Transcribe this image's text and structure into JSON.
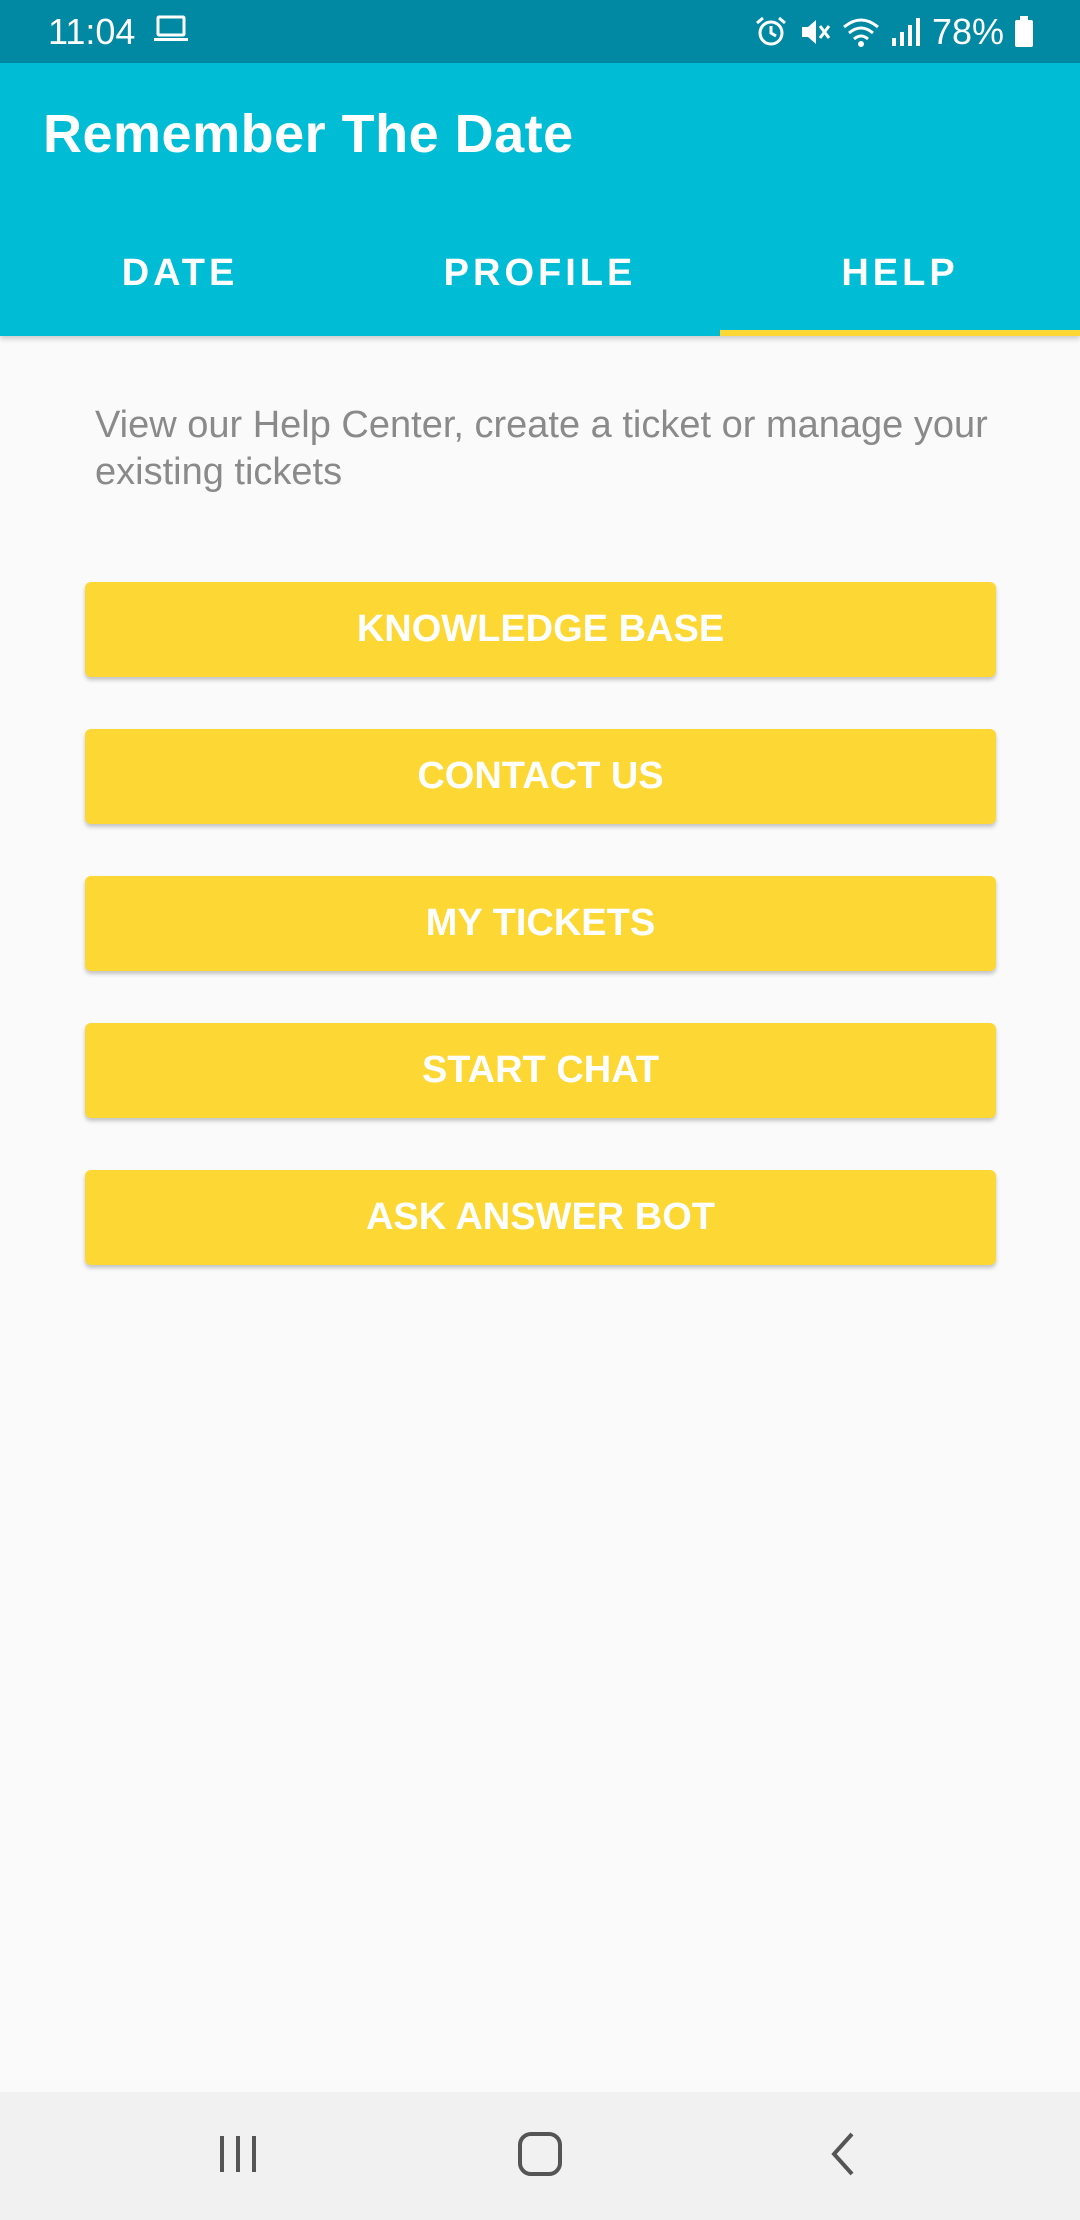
{
  "status_bar": {
    "time": "11:04",
    "battery_percent": "78%",
    "icons": [
      "laptop-icon",
      "alarm-icon",
      "mute-icon",
      "wifi-icon",
      "signal-icon",
      "battery-icon"
    ]
  },
  "app_bar": {
    "title": "Remember The Date"
  },
  "tabs": [
    {
      "label": "DATE",
      "selected": false
    },
    {
      "label": "PROFILE",
      "selected": false
    },
    {
      "label": "HELP",
      "selected": true
    }
  ],
  "help": {
    "description": "View our Help Center, create a ticket or manage your existing tickets",
    "buttons": [
      {
        "label": "KNOWLEDGE BASE"
      },
      {
        "label": "CONTACT US"
      },
      {
        "label": "MY TICKETS"
      },
      {
        "label": "START CHAT"
      },
      {
        "label": "ASK ANSWER BOT"
      }
    ]
  },
  "nav_bar": {
    "icons": [
      "recent-apps-icon",
      "home-icon",
      "back-icon"
    ]
  },
  "colors": {
    "status_bar": "#0188a3",
    "app_bar": "#00bcd4",
    "accent": "#fdd835",
    "background": "#fafafa",
    "description_text": "#8a8a8a"
  }
}
